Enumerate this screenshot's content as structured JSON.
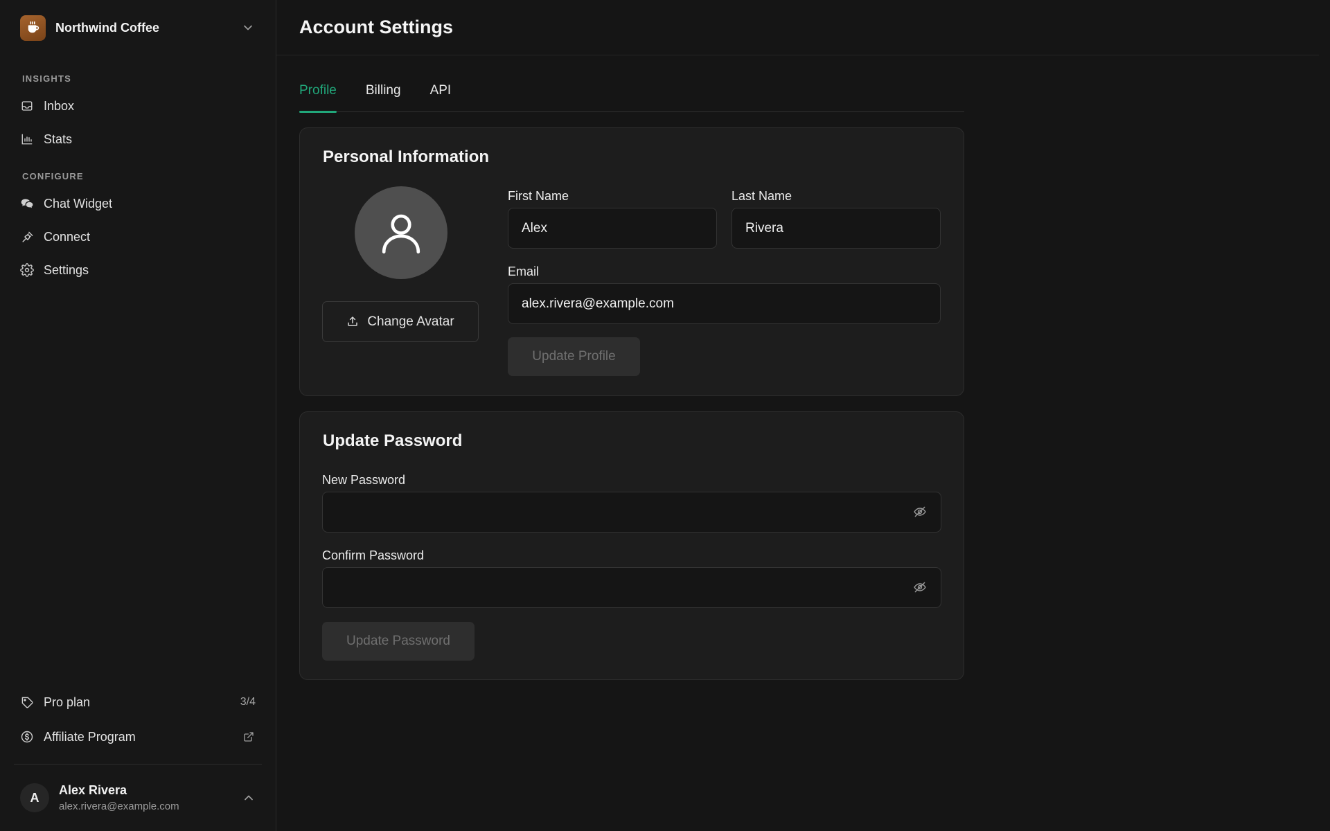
{
  "workspace": {
    "name": "Northwind Coffee"
  },
  "sidebar": {
    "sections": [
      {
        "label": "INSIGHTS",
        "items": [
          {
            "label": "Inbox",
            "icon": "inbox-icon"
          },
          {
            "label": "Stats",
            "icon": "bar-chart-icon"
          }
        ]
      },
      {
        "label": "CONFIGURE",
        "items": [
          {
            "label": "Chat Widget",
            "icon": "chat-icon"
          },
          {
            "label": "Connect",
            "icon": "plug-icon"
          },
          {
            "label": "Settings",
            "icon": "gear-icon"
          }
        ]
      }
    ],
    "plan": {
      "label": "Pro plan",
      "count": "3/4"
    },
    "affiliate": {
      "label": "Affiliate Program"
    },
    "user": {
      "initial": "A",
      "name": "Alex Rivera",
      "email": "alex.rivera@example.com"
    }
  },
  "header": {
    "title": "Account Settings"
  },
  "tabs": [
    {
      "label": "Profile",
      "active": true
    },
    {
      "label": "Billing"
    },
    {
      "label": "API"
    }
  ],
  "personal": {
    "title": "Personal Information",
    "change_avatar": "Change Avatar",
    "first_name": {
      "label": "First Name",
      "value": "Alex"
    },
    "last_name": {
      "label": "Last Name",
      "value": "Rivera"
    },
    "email": {
      "label": "Email",
      "value": "alex.rivera@example.com"
    },
    "submit": "Update Profile"
  },
  "password": {
    "title": "Update Password",
    "new": {
      "label": "New Password",
      "value": ""
    },
    "confirm": {
      "label": "Confirm Password",
      "value": ""
    },
    "submit": "Update Password"
  },
  "colors": {
    "accent": "#21a77a",
    "background": "#151515",
    "card": "#1d1d1d",
    "workspace_logo": "#a5632d"
  }
}
